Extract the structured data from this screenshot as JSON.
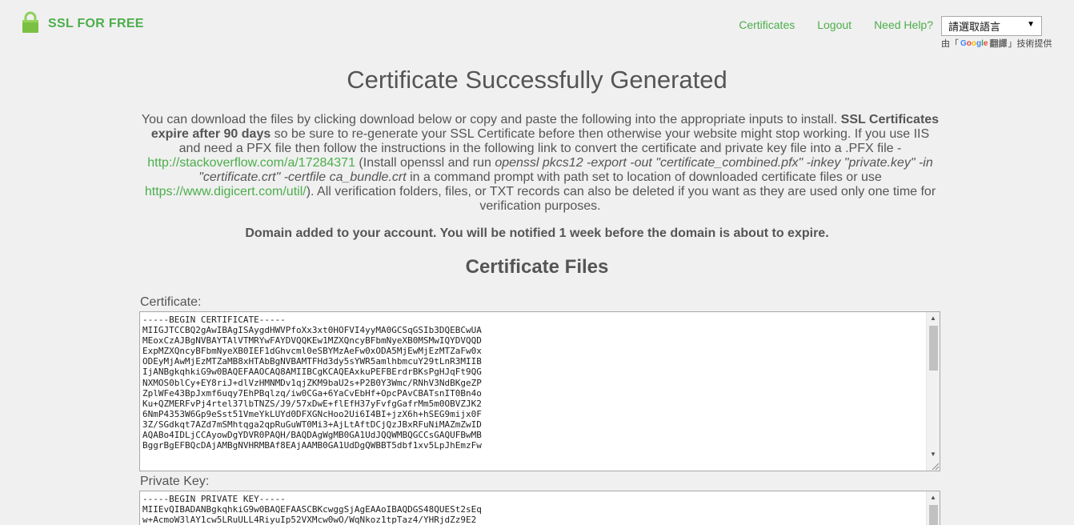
{
  "header": {
    "brand": "SSL FOR FREE",
    "nav": [
      "Certificates",
      "Logout",
      "Need Help?"
    ],
    "language_select": "請選取語言",
    "powered_prefix": "由「",
    "powered_translate": "翻譯",
    "powered_suffix": "」技術提供"
  },
  "main": {
    "title": "Certificate Successfully Generated",
    "intro": {
      "p1": "You can download the files by clicking download below or copy and paste the following into the appropriate inputs to install. ",
      "bold1": "SSL Certificates expire after 90 days",
      "p2": " so be sure to re-generate your SSL Certificate before then otherwise your website might stop working. If you use IIS and need a PFX file then follow the instructions in the following link to convert the certificate and private key file into a .PFX file - ",
      "link1": "http://stackoverflow.com/a/17284371",
      "p3": " (Install openssl and run ",
      "italic1": "openssl pkcs12 -export -out \"certificate_combined.pfx\" -inkey \"private.key\" -in \"certificate.crt\" -certfile ca_bundle.crt",
      "p4": " in a command prompt with path set to location of downloaded certificate files or use ",
      "link2": "https://www.digicert.com/util/",
      "p5": "). All verification folders, files, or TXT records can also be deleted if you want as they are used only one time for verification purposes."
    },
    "notice": "Domain added to your account. You will be notified 1 week before the domain is about to expire.",
    "section_title": "Certificate Files",
    "certificate_label": "Certificate:",
    "certificate_text": "-----BEGIN CERTIFICATE-----\nMIIGJTCCBQ2gAwIBAgISAygdHWVPfoXx3xt0HOFVI4yyMA0GCSqGSIb3DQEBCwUA\nMEoxCzAJBgNVBAYTAlVTMRYwFAYDVQQKEw1MZXQncyBFbmNyeXB0MSMwIQYDVQQD\nExpMZXQncyBFbmNyeXB0IEF1dGhvcml0eSBYMzAeFw0xODA5MjEwMjEzMTZaFw0x\nODEyMjAwMjEzMTZaMB8xHTAbBgNVBAMTFHd3dy5sYWR5amlhbmcuY29tLnR3MIIB\nIjANBgkqhkiG9w0BAQEFAAOCAQ8AMIIBCgKCAQEAxkuPEFBErdrBKsPgHJqFt9QG\nNXMOS0blCy+EY8riJ+dlVzHMNMDv1qjZKM9baU2s+P2B0Y3Wmc/RNhV3NdBKgeZP\nZplWFe43BpJxmf6uqy7EhPBqlzq/iw0CGa+6YaCvEbHf+OpcPAvCBATsnIT0Bn4o\nKu+QZMERFvPj4rtel37lbTNZS/J9/57xDwE+flEfH37yFvfgGafrMm5m0OBVZJK2\n6NmP4353W6Gp9eSst51VmeYkLUYd0DFXGNcHoo2Ui6I4BI+jzX6h+hSEG9mijx0F\n3Z/SGdkqt7AZd7mSMhtqga2qpRuGuWT0Mi3+AjLtAftDCjQzJBxRFuNiMAZmZwID\nAQABo4IDLjCCAyowDgYDVR0PAQH/BAQDAgWgMB0GA1UdJQQWMBQGCCsGAQUFBwMB\nBggrBgEFBQcDAjAMBgNVHRMBAf8EAjAAMB0GA1UdDgQWBBT5dbf1xv5LpJhEmzFw",
    "private_key_label": "Private Key:",
    "private_key_text": "-----BEGIN PRIVATE KEY-----\nMIIEvQIBADANBgkqhkiG9w0BAQEFAASCBKcwggSjAgEAAoIBAQDGS48QUESt2sEq\nw+AcmoW3lAY1cw5LRuULL4RiyuIp52VXMcw0wO/WqNkoz1tpTaz4/YHRjdZz9E2"
  }
}
